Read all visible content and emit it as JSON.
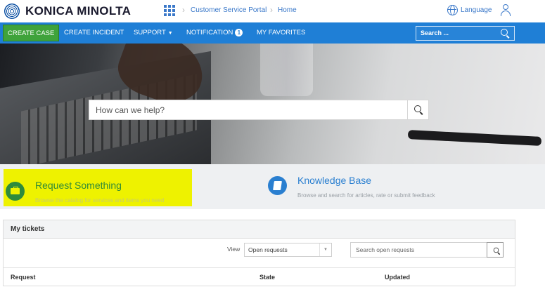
{
  "header": {
    "brand": "KONICA MINOLTA",
    "breadcrumbs": [
      "Customer Service Portal",
      "Home"
    ],
    "language_label": "Language"
  },
  "nav": {
    "items": [
      {
        "label": "CREATE CASE"
      },
      {
        "label": "CREATE INCIDENT"
      },
      {
        "label": "SUPPORT"
      },
      {
        "label": "NOTIFICATION"
      },
      {
        "label": "MY FAVORITES"
      }
    ],
    "notification_count": "1",
    "search_placeholder": "Search ..."
  },
  "hero": {
    "search_placeholder": "How can we help?"
  },
  "cards": {
    "request": {
      "title": "Request Something",
      "description": "Browse the catalog for services and items you need"
    },
    "knowledge": {
      "title": "Knowledge Base",
      "description": "Browse and search for articles, rate or submit feedback"
    }
  },
  "tickets": {
    "title": "My tickets",
    "view_label": "View",
    "view_selected": "Open requests",
    "search_placeholder": "Search open requests",
    "columns": [
      "Request",
      "State",
      "Updated"
    ]
  },
  "colors": {
    "nav_blue": "#1f7fd6",
    "create_case_green": "#3fa33b",
    "highlight_yellow": "#eef200",
    "link_blue": "#3a78c9"
  }
}
